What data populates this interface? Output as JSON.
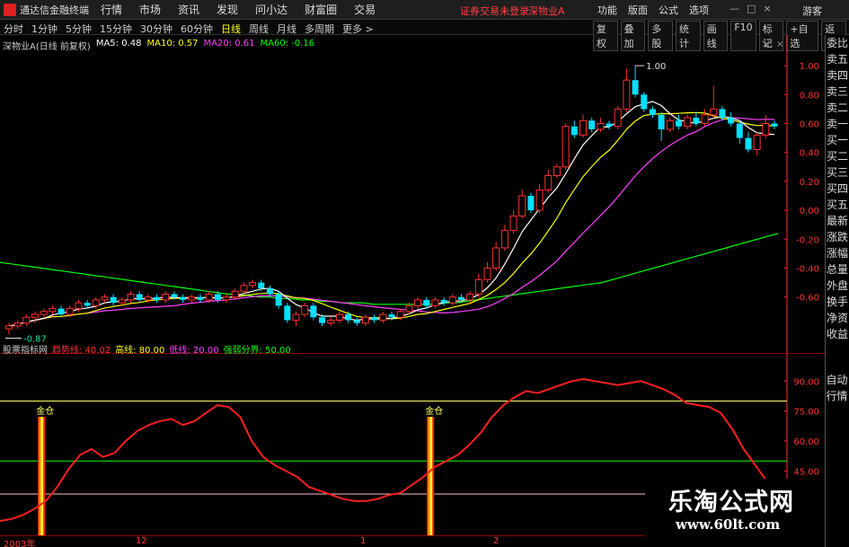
{
  "menubar": {
    "title": "通达信金融终端",
    "items": [
      "行情",
      "市场",
      "资讯",
      "发现",
      "问小达",
      "财富圈",
      "交易"
    ],
    "notice": "证券交易未登录",
    "stock": "深物业A",
    "right_items": [
      "功能",
      "版面",
      "公式",
      "选项"
    ],
    "guest": "游客"
  },
  "toolbar": {
    "periods": [
      "分时",
      "1分钟",
      "5分钟",
      "15分钟",
      "30分钟",
      "60分钟",
      "日线",
      "周线",
      "月线",
      "多周期",
      "更多 >"
    ],
    "active_period": "日线",
    "buttons": [
      "复权",
      "叠加",
      "多股",
      "统计",
      "画线",
      "F10",
      "标记",
      "+自选",
      "返回"
    ],
    "side_tab": "L"
  },
  "main_chart": {
    "stock_label": "深物业A(日线 前复权)",
    "ma5": "MA5: 0.48",
    "ma10": "MA10: 0.57",
    "ma20": "MA20: 0.61",
    "ma60": "MA60: -0.16",
    "high_marker": "1.00",
    "low_marker": "-0.87",
    "colors": {
      "ma5": "#ffffff",
      "ma10": "#ffff00",
      "ma20": "#ff40ff",
      "ma60": "#00ff00",
      "up": "#ff3030",
      "down": "#00e0ff",
      "axis": "#ff3030"
    }
  },
  "oscillator": {
    "name": "股票指标网",
    "trend": "趋势线: 40.02",
    "high": "高线: 80.00",
    "low": "低线: 20.00",
    "mid": "强弱分界: 50.00",
    "signal_label": "金仓",
    "colors": {
      "trend": "#ff2020",
      "high": "#ffff66",
      "mid": "#00ff00",
      "low": "#ffbbbb"
    }
  },
  "sidepanel": {
    "items": [
      "委比",
      "卖五",
      "卖四",
      "卖三",
      "卖二",
      "卖一",
      "买一",
      "买二",
      "买三",
      "买四",
      "买五",
      "最新",
      "涨跌",
      "涨幅",
      "总量",
      "外盘",
      "换手",
      "净资",
      "收益"
    ],
    "auto": [
      "自动",
      "行情"
    ]
  },
  "date_axis": [
    "2003年",
    "12",
    "1",
    "2"
  ],
  "watermark": {
    "title": "乐淘公式网",
    "url": "www.60lt.com"
  },
  "chart_data": [
    {
      "type": "line",
      "title": "深物业A(日线 前复权)",
      "ylim": [
        -0.9,
        1.1
      ],
      "y_ticks": [
        1.0,
        0.8,
        0.6,
        0.4,
        0.2,
        0.0,
        -0.2,
        -0.4,
        -0.6
      ],
      "candles": [
        [
          -0.82,
          -0.8,
          -0.86,
          -0.78
        ],
        [
          -0.8,
          -0.78,
          -0.82,
          -0.76
        ],
        [
          -0.78,
          -0.74,
          -0.8,
          -0.72
        ],
        [
          -0.74,
          -0.72,
          -0.78,
          -0.7
        ],
        [
          -0.72,
          -0.7,
          -0.74,
          -0.68
        ],
        [
          -0.7,
          -0.68,
          -0.72,
          -0.66
        ],
        [
          -0.68,
          -0.72,
          -0.74,
          -0.66
        ],
        [
          -0.72,
          -0.68,
          -0.74,
          -0.66
        ],
        [
          -0.68,
          -0.64,
          -0.7,
          -0.62
        ],
        [
          -0.64,
          -0.66,
          -0.68,
          -0.62
        ],
        [
          -0.66,
          -0.62,
          -0.68,
          -0.6
        ],
        [
          -0.62,
          -0.6,
          -0.64,
          -0.58
        ],
        [
          -0.6,
          -0.64,
          -0.66,
          -0.58
        ],
        [
          -0.64,
          -0.62,
          -0.66,
          -0.6
        ],
        [
          -0.62,
          -0.58,
          -0.64,
          -0.56
        ],
        [
          -0.58,
          -0.62,
          -0.64,
          -0.56
        ],
        [
          -0.62,
          -0.6,
          -0.64,
          -0.58
        ],
        [
          -0.6,
          -0.62,
          -0.64,
          -0.58
        ],
        [
          -0.62,
          -0.58,
          -0.64,
          -0.56
        ],
        [
          -0.58,
          -0.6,
          -0.62,
          -0.56
        ],
        [
          -0.6,
          -0.62,
          -0.64,
          -0.58
        ],
        [
          -0.62,
          -0.6,
          -0.64,
          -0.58
        ],
        [
          -0.6,
          -0.62,
          -0.64,
          -0.58
        ],
        [
          -0.62,
          -0.58,
          -0.64,
          -0.56
        ],
        [
          -0.58,
          -0.62,
          -0.64,
          -0.56
        ],
        [
          -0.62,
          -0.6,
          -0.64,
          -0.58
        ],
        [
          -0.6,
          -0.56,
          -0.62,
          -0.54
        ],
        [
          -0.56,
          -0.52,
          -0.58,
          -0.5
        ],
        [
          -0.52,
          -0.5,
          -0.54,
          -0.48
        ],
        [
          -0.5,
          -0.54,
          -0.56,
          -0.48
        ],
        [
          -0.54,
          -0.58,
          -0.6,
          -0.52
        ],
        [
          -0.58,
          -0.66,
          -0.68,
          -0.56
        ],
        [
          -0.66,
          -0.76,
          -0.78,
          -0.64
        ],
        [
          -0.76,
          -0.72,
          -0.8,
          -0.7
        ],
        [
          -0.72,
          -0.66,
          -0.74,
          -0.64
        ],
        [
          -0.66,
          -0.74,
          -0.76,
          -0.64
        ],
        [
          -0.74,
          -0.78,
          -0.8,
          -0.72
        ],
        [
          -0.78,
          -0.76,
          -0.8,
          -0.74
        ],
        [
          -0.76,
          -0.72,
          -0.78,
          -0.7
        ],
        [
          -0.72,
          -0.76,
          -0.78,
          -0.7
        ],
        [
          -0.76,
          -0.78,
          -0.8,
          -0.74
        ],
        [
          -0.78,
          -0.74,
          -0.8,
          -0.72
        ],
        [
          -0.74,
          -0.76,
          -0.78,
          -0.72
        ],
        [
          -0.76,
          -0.72,
          -0.78,
          -0.7
        ],
        [
          -0.72,
          -0.74,
          -0.76,
          -0.7
        ],
        [
          -0.74,
          -0.7,
          -0.76,
          -0.68
        ],
        [
          -0.7,
          -0.66,
          -0.72,
          -0.64
        ],
        [
          -0.66,
          -0.62,
          -0.68,
          -0.6
        ],
        [
          -0.62,
          -0.66,
          -0.68,
          -0.6
        ],
        [
          -0.66,
          -0.62,
          -0.68,
          -0.6
        ],
        [
          -0.62,
          -0.64,
          -0.66,
          -0.6
        ],
        [
          -0.64,
          -0.6,
          -0.66,
          -0.58
        ],
        [
          -0.6,
          -0.62,
          -0.64,
          -0.58
        ],
        [
          -0.62,
          -0.58,
          -0.64,
          -0.56
        ],
        [
          -0.58,
          -0.48,
          -0.6,
          -0.44
        ],
        [
          -0.48,
          -0.4,
          -0.5,
          -0.36
        ],
        [
          -0.4,
          -0.26,
          -0.42,
          -0.22
        ],
        [
          -0.26,
          -0.14,
          -0.28,
          -0.1
        ],
        [
          -0.14,
          -0.04,
          -0.16,
          0.0
        ],
        [
          -0.04,
          0.1,
          -0.06,
          0.14
        ],
        [
          0.1,
          0.0,
          -0.02,
          0.12
        ],
        [
          0.0,
          0.14,
          -0.02,
          0.18
        ],
        [
          0.14,
          0.24,
          0.12,
          0.28
        ],
        [
          0.24,
          0.3,
          0.22,
          0.32
        ],
        [
          0.3,
          0.58,
          0.28,
          0.6
        ],
        [
          0.58,
          0.52,
          0.5,
          0.62
        ],
        [
          0.52,
          0.62,
          0.5,
          0.66
        ],
        [
          0.62,
          0.56,
          0.54,
          0.64
        ],
        [
          0.56,
          0.6,
          0.54,
          0.64
        ],
        [
          0.6,
          0.58,
          0.56,
          0.62
        ],
        [
          0.58,
          0.7,
          0.56,
          0.72
        ],
        [
          0.7,
          0.9,
          0.68,
          0.98
        ],
        [
          0.9,
          0.8,
          0.78,
          1.0
        ],
        [
          0.8,
          0.7,
          0.68,
          0.82
        ],
        [
          0.7,
          0.66,
          0.64,
          0.72
        ],
        [
          0.66,
          0.56,
          0.48,
          0.68
        ],
        [
          0.56,
          0.62,
          0.54,
          0.64
        ],
        [
          0.62,
          0.58,
          0.56,
          0.66
        ],
        [
          0.58,
          0.64,
          0.56,
          0.66
        ],
        [
          0.64,
          0.6,
          0.58,
          0.68
        ],
        [
          0.6,
          0.66,
          0.58,
          0.7
        ],
        [
          0.66,
          0.7,
          0.64,
          0.86
        ],
        [
          0.7,
          0.64,
          0.62,
          0.72
        ],
        [
          0.64,
          0.6,
          0.58,
          0.68
        ],
        [
          0.6,
          0.5,
          0.46,
          0.62
        ],
        [
          0.5,
          0.42,
          0.4,
          0.54
        ],
        [
          0.42,
          0.52,
          0.38,
          0.54
        ],
        [
          0.52,
          0.6,
          0.5,
          0.66
        ],
        [
          0.6,
          0.58,
          0.56,
          0.62
        ]
      ],
      "series": [
        {
          "name": "MA60",
          "values": [
            -0.36,
            -0.37,
            -0.38,
            -0.39,
            -0.4,
            -0.41,
            -0.42,
            -0.43,
            -0.44,
            -0.45,
            -0.46,
            -0.47,
            -0.48,
            -0.49,
            -0.5,
            -0.51,
            -0.52,
            -0.53,
            -0.54,
            -0.55,
            -0.56,
            -0.57,
            -0.58,
            -0.58,
            -0.59,
            -0.6,
            -0.6,
            -0.61,
            -0.61,
            -0.62,
            -0.62,
            -0.63,
            -0.63,
            -0.64,
            -0.64,
            -0.64,
            -0.65,
            -0.65,
            -0.65,
            -0.65,
            -0.65,
            -0.65,
            -0.65,
            -0.64,
            -0.64,
            -0.63,
            -0.62,
            -0.61,
            -0.6,
            -0.59,
            -0.58,
            -0.57,
            -0.56,
            -0.55,
            -0.54,
            -0.53,
            -0.52,
            -0.51,
            -0.5,
            -0.48,
            -0.46,
            -0.44,
            -0.42,
            -0.4,
            -0.38,
            -0.36,
            -0.34,
            -0.32,
            -0.3,
            -0.28,
            -0.26,
            -0.24,
            -0.22,
            -0.2,
            -0.18,
            -0.16
          ]
        }
      ]
    },
    {
      "type": "line",
      "title": "股票指标网",
      "ylim": [
        20,
        100
      ],
      "y_ticks": [
        90.0,
        75.0,
        60.0,
        45.0,
        30.0
      ],
      "series": [
        {
          "name": "趋势线",
          "values": [
            20,
            21,
            23,
            26,
            30,
            37,
            46,
            53,
            56,
            52,
            54,
            60,
            65,
            68,
            70,
            71,
            68,
            70,
            74,
            78,
            77,
            72,
            60,
            52,
            48,
            45,
            42,
            37,
            35,
            33,
            31,
            30,
            30,
            31,
            33,
            34,
            38,
            42,
            47,
            50,
            53,
            58,
            64,
            72,
            78,
            82,
            85,
            84,
            86,
            88,
            90,
            91,
            90,
            89,
            88,
            89,
            90,
            88,
            86,
            83,
            79,
            78,
            77,
            74,
            66,
            56,
            48,
            40,
            39
          ]
        }
      ],
      "reference_lines": {
        "high": 80,
        "mid": 50,
        "low": 20
      },
      "signals": [
        {
          "index": 3,
          "label": "金仓"
        },
        {
          "index": 37,
          "label": "金仓"
        }
      ]
    }
  ]
}
